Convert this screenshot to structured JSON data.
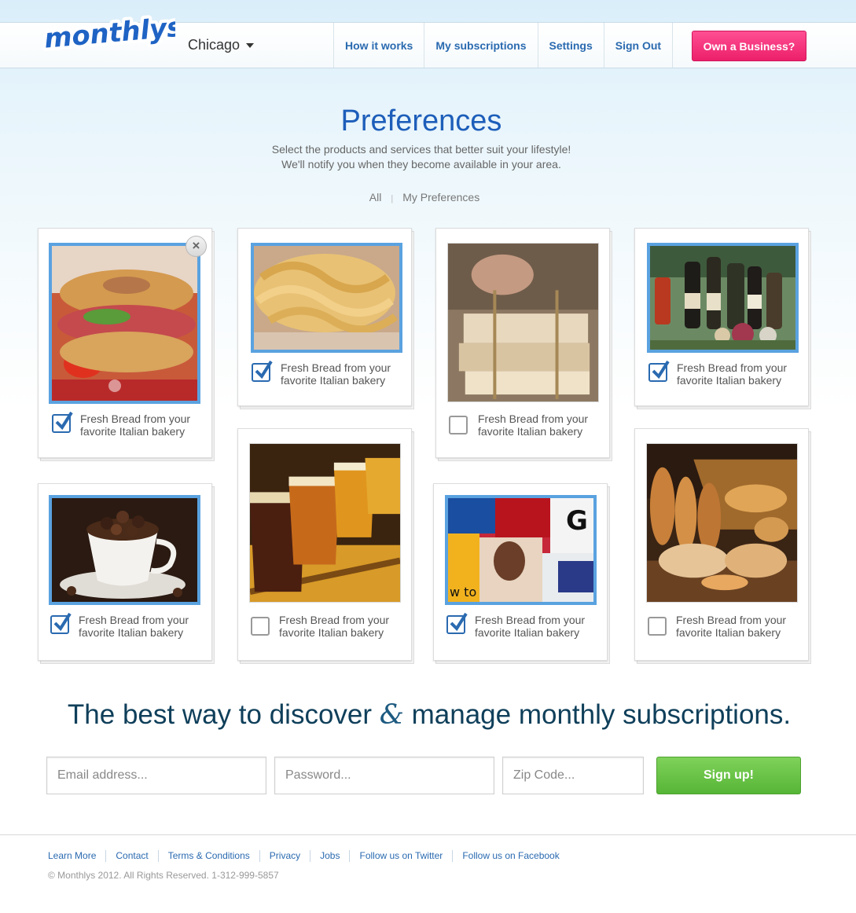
{
  "brand": {
    "logo_text": "monthlys"
  },
  "header": {
    "city": "Chicago",
    "nav": [
      "How it works",
      "My subscriptions",
      "Settings",
      "Sign Out"
    ],
    "business_button": "Own a Business?"
  },
  "main": {
    "title": "Preferences",
    "subtitle_line1": "Select the products and services that better suit your lifestyle!",
    "subtitle_line2": "We'll notify you when they become available in your area.",
    "filter_all": "All",
    "filter_separator": "|",
    "filter_mine": "My Preferences",
    "close_glyph": "×",
    "cards": [
      {
        "caption_line1": "Fresh Bread from your",
        "caption_line2": "favorite Italian bakery",
        "checked": true,
        "image": "bagel-sandwich"
      },
      {
        "caption_line1": "Fresh Bread from your",
        "caption_line2": "favorite Italian bakery",
        "checked": true,
        "image": "fresh-pasta"
      },
      {
        "caption_line1": "Fresh Bread from your",
        "caption_line2": "favorite Italian bakery",
        "checked": false,
        "image": "firewood-bundle"
      },
      {
        "caption_line1": "Fresh Bread from your",
        "caption_line2": "favorite Italian bakery",
        "checked": true,
        "image": "wine-bottles"
      },
      {
        "caption_line1": "Fresh Bread from your",
        "caption_line2": "favorite Italian bakery",
        "checked": true,
        "image": "coffee-cup-beans"
      },
      {
        "caption_line1": "Fresh Bread from your",
        "caption_line2": "favorite Italian bakery",
        "checked": false,
        "image": "beer-glasses"
      },
      {
        "caption_line1": "Fresh Bread from your",
        "caption_line2": "favorite Italian bakery",
        "checked": true,
        "image": "magazines"
      },
      {
        "caption_line1": "Fresh Bread from your",
        "caption_line2": "favorite Italian bakery",
        "checked": false,
        "image": "bread-basket"
      }
    ]
  },
  "signup": {
    "tagline_part1": "The best way to discover ",
    "tagline_amp": "&",
    "tagline_part2": " manage monthly subscriptions.",
    "email_placeholder": "Email address...",
    "password_placeholder": "Password...",
    "zip_placeholder": "Zip Code...",
    "button": "Sign up!"
  },
  "footer": {
    "links": [
      "Learn More",
      "Contact",
      "Terms & Conditions",
      "Privacy",
      "Jobs",
      "Follow us on Twitter",
      "Follow us on Facebook"
    ],
    "copyright": "© Monthlys 2012. All Rights Reserved. 1-312-999-5857"
  },
  "colors": {
    "brand_blue": "#1d5eba",
    "link_blue": "#2a6ab0",
    "pink_button": "#ec1f6a",
    "green_button": "#56b536",
    "selected_border": "#5aa2e0"
  }
}
